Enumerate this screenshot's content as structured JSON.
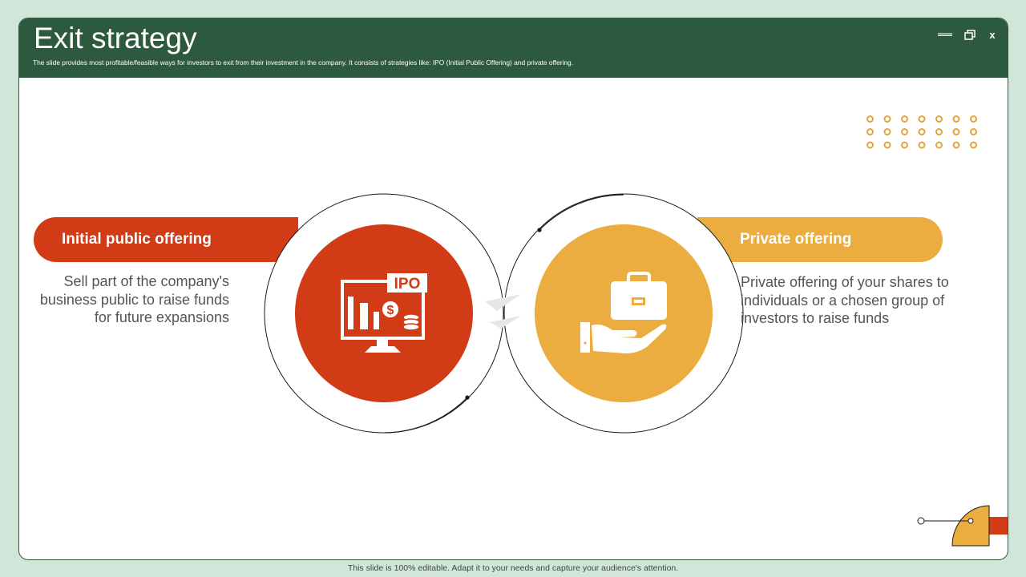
{
  "slide": {
    "title": "Exit strategy",
    "subtitle": "The slide provides most profitable/feasible ways for investors to exit from their investment in the company. It consists of strategies like: IPO (Initial Public Offering) and private offering."
  },
  "window_controls": {
    "minimize_icon": "minimize-icon",
    "maximize_icon": "restore-icon",
    "close_label": "x"
  },
  "strategies": [
    {
      "label": "Initial public offering",
      "description": "Sell part of the company's business public to raise funds for future expansions",
      "icon": "ipo-monitor-icon",
      "icon_text": "IPO",
      "color": "#d13b16"
    },
    {
      "label": "Private offering",
      "description": "Private offering of your shares to individuals or a chosen group of investors to raise funds",
      "icon": "briefcase-hand-icon",
      "color": "#ebad3f"
    }
  ],
  "colors": {
    "header": "#2d5a3e",
    "background": "#cfe6d9",
    "accent_red": "#d13b16",
    "accent_yellow": "#ebad3f"
  },
  "footer": {
    "text": "This slide is 100% editable. Adapt it to your needs and capture your audience's attention."
  }
}
